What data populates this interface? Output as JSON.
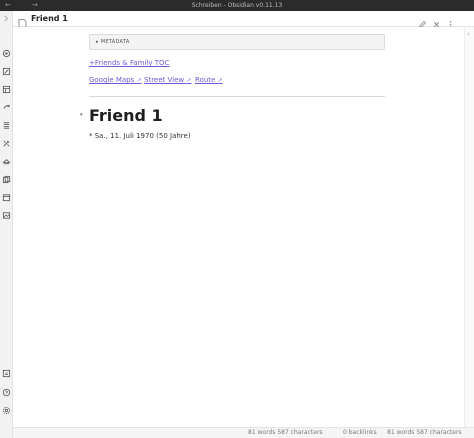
{
  "window": {
    "title": "Schreiben - Obsidian v0.11.13",
    "back_glyph": "←",
    "forward_glyph": "→"
  },
  "tab": {
    "title": "Friend 1"
  },
  "note": {
    "metadata_label": "▸ METADATA",
    "toc_link": "+Friends & Family TOC",
    "map_links": [
      "Google Maps",
      "Street View",
      "Route"
    ],
    "heading": "Friend 1",
    "fold_glyph": "▾",
    "birthday": "* Sa., 11. Juli 1970 (50 Jahre)"
  },
  "status": {
    "words_left": "81 words 587 characters",
    "backlinks": "0 backlinks",
    "words_right": "81 words 587 characters"
  },
  "colors": {
    "link": "#6b5bd6",
    "titlebar": "#2b2b2b"
  }
}
